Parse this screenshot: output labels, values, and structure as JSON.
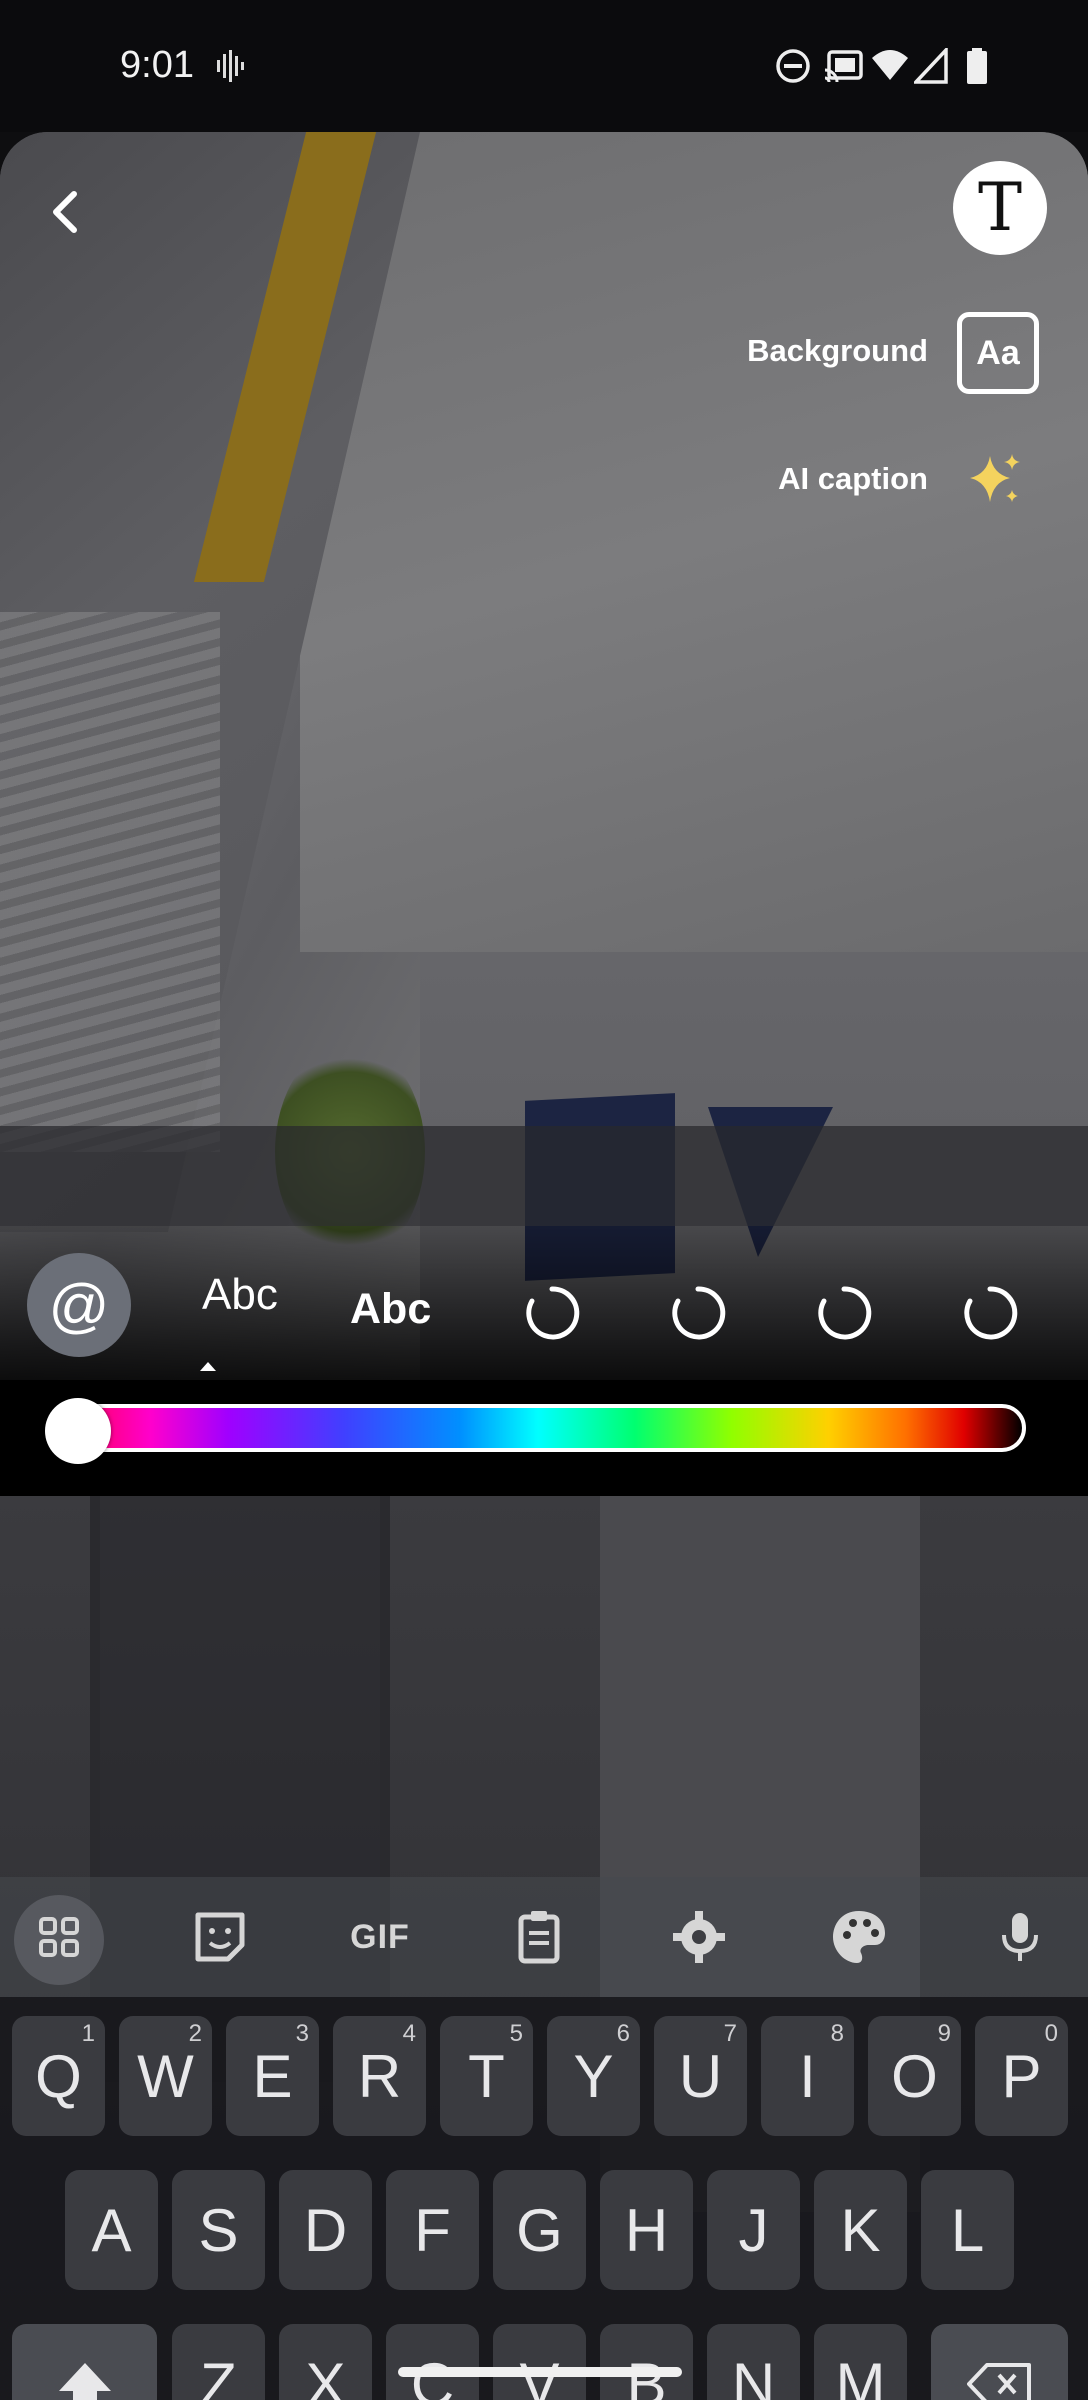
{
  "status_bar": {
    "time": "9:01"
  },
  "editor": {
    "background_label": "Background",
    "background_button": "Aa",
    "ai_caption_label": "AI caption",
    "text_tool_glyph": "T",
    "mention_glyph": "@"
  },
  "text_styles": [
    {
      "label": "Abc",
      "selected": true
    },
    {
      "label": "Abc",
      "selected": false
    }
  ],
  "color_slider": {
    "selected_position": 0.0
  },
  "keyboard": {
    "toolbar": {
      "gif_label": "GIF"
    },
    "row1": [
      {
        "key": "Q",
        "hint": "1"
      },
      {
        "key": "W",
        "hint": "2"
      },
      {
        "key": "E",
        "hint": "3"
      },
      {
        "key": "R",
        "hint": "4"
      },
      {
        "key": "T",
        "hint": "5"
      },
      {
        "key": "Y",
        "hint": "6"
      },
      {
        "key": "U",
        "hint": "7"
      },
      {
        "key": "I",
        "hint": "8"
      },
      {
        "key": "O",
        "hint": "9"
      },
      {
        "key": "P",
        "hint": "0"
      }
    ],
    "row2": [
      "A",
      "S",
      "D",
      "F",
      "G",
      "H",
      "J",
      "K",
      "L"
    ],
    "row3": [
      "Z",
      "X",
      "C",
      "V",
      "B",
      "N",
      "M"
    ]
  },
  "colors": {
    "accent_white": "#ffffff",
    "key_background": "#3a3b40"
  }
}
